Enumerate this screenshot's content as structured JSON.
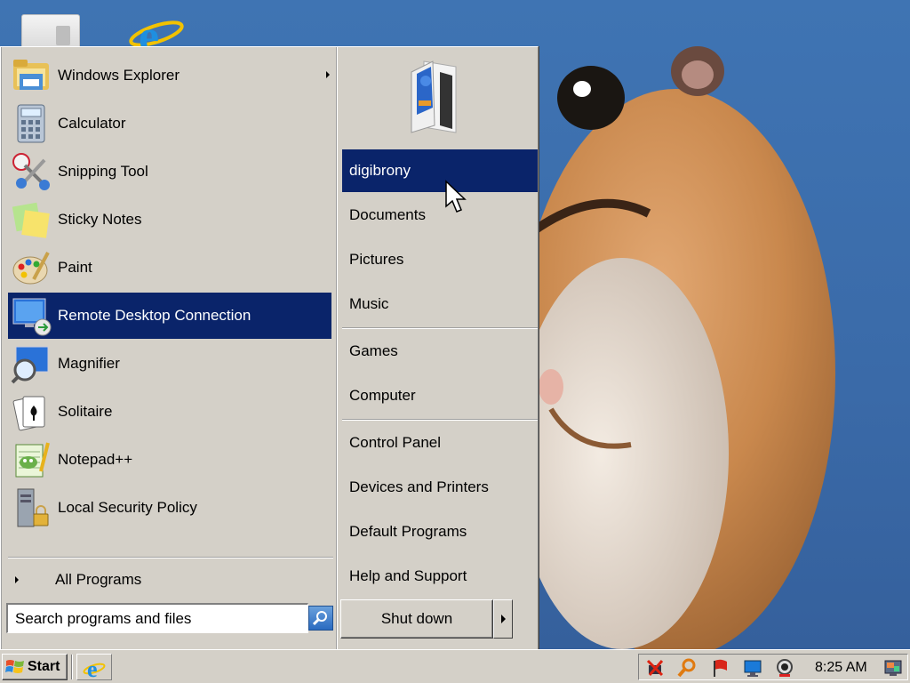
{
  "start_menu": {
    "programs": [
      {
        "label": "Windows Explorer",
        "icon": "folder-explorer-icon",
        "has_submenu": true
      },
      {
        "label": "Calculator",
        "icon": "calculator-icon"
      },
      {
        "label": "Snipping Tool",
        "icon": "scissors-icon"
      },
      {
        "label": "Sticky Notes",
        "icon": "sticky-notes-icon"
      },
      {
        "label": "Paint",
        "icon": "paint-palette-icon"
      },
      {
        "label": "Remote Desktop Connection",
        "icon": "remote-desktop-icon",
        "selected": true
      },
      {
        "label": "Magnifier",
        "icon": "magnifier-icon"
      },
      {
        "label": "Solitaire",
        "icon": "solitaire-cards-icon"
      },
      {
        "label": "Notepad++",
        "icon": "notepad-plus-icon"
      },
      {
        "label": "Local Security Policy",
        "icon": "security-policy-icon"
      }
    ],
    "all_programs_label": "All Programs",
    "search_placeholder": "Search programs and files",
    "places": [
      {
        "label": "digibrony",
        "selected": true
      },
      {
        "label": "Documents"
      },
      {
        "label": "Pictures"
      },
      {
        "label": "Music"
      },
      {
        "label": "Games"
      },
      {
        "label": "Computer"
      },
      {
        "label": "Control Panel"
      },
      {
        "label": "Devices and Printers"
      },
      {
        "label": "Default Programs"
      },
      {
        "label": "Help and Support"
      }
    ],
    "shutdown_label": "Shut down"
  },
  "taskbar": {
    "start_label": "Start",
    "clock": "8:25 AM",
    "tray_icons": [
      "network-error-icon",
      "search-magnifier-icon",
      "action-center-flag-icon",
      "monitor-icon",
      "webcam-icon",
      "desktop-show-icon"
    ]
  },
  "colors": {
    "desktop_bg": "#3a6ea5",
    "menu_bg": "#d4d0c8",
    "selection": "#0a246a"
  }
}
